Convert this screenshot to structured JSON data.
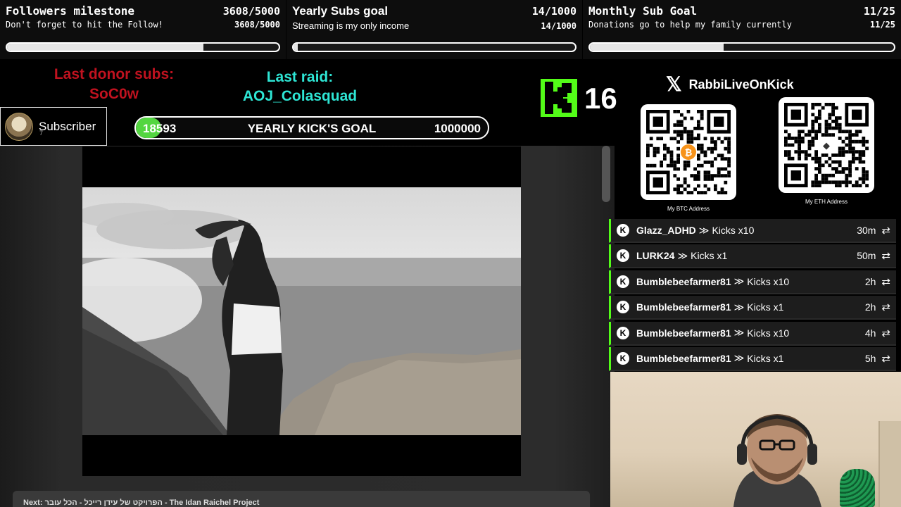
{
  "goals": [
    {
      "title": "Followers milestone",
      "count": "3608/5000",
      "subtitle": "Don't forget to hit the Follow!",
      "subcount": "3608/5000",
      "progress": 0.7216
    },
    {
      "title": "Yearly Subs goal",
      "count": "14/1000",
      "subtitle": "Streaming is my only income",
      "subcount": "14/1000",
      "progress": 0.014
    },
    {
      "title": "Monthly Sub Goal",
      "count": "11/25",
      "subtitle": "Donations go to help my family currently",
      "subcount": "11/25",
      "progress": 0.44
    }
  ],
  "donor": {
    "label": "Last donor subs:",
    "name": "SoC0w"
  },
  "raid": {
    "label": "Last raid:",
    "name": "AOJ_Colasquad"
  },
  "subscriber": {
    "label": "Subscriber",
    "small": "7"
  },
  "kick_goal": {
    "current": "18593",
    "label": "YEARLY KICK'S GOAL",
    "goal": "1000000",
    "progress": 0.0186
  },
  "kick_counter": {
    "value": "16"
  },
  "social": {
    "handle": "RabbiLiveOnKick",
    "icon": "x-logo-icon"
  },
  "qr_codes": [
    {
      "label": "My BTC Address",
      "icon": "bitcoin-icon"
    },
    {
      "label": "My ETH Address",
      "icon": "ethereum-icon"
    }
  ],
  "video": {
    "next_label": "Next:",
    "next_title": "הפרויקט של עידן רייכל - הכל עובר - The Idan Raichel Project"
  },
  "feed": [
    {
      "user": "Glazz_ADHD",
      "sep": "≫",
      "item": "Kicks x10",
      "time": "30m"
    },
    {
      "user": "LURK24",
      "sep": "≫",
      "item": "Kicks x1",
      "time": "50m"
    },
    {
      "user": "Bumblebeefarmer81",
      "sep": "≫",
      "item": "Kicks x10",
      "time": "2h"
    },
    {
      "user": "Bumblebeefarmer81",
      "sep": "≫",
      "item": "Kicks x1",
      "time": "2h"
    },
    {
      "user": "Bumblebeefarmer81",
      "sep": "≫",
      "item": "Kicks x10",
      "time": "4h"
    },
    {
      "user": "Bumblebeefarmer81",
      "sep": "≫",
      "item": "Kicks x1",
      "time": "5h"
    }
  ],
  "colors": {
    "kick_green": "#53fc18",
    "donor_red": "#c0121f",
    "raid_cyan": "#2ee6d5"
  }
}
